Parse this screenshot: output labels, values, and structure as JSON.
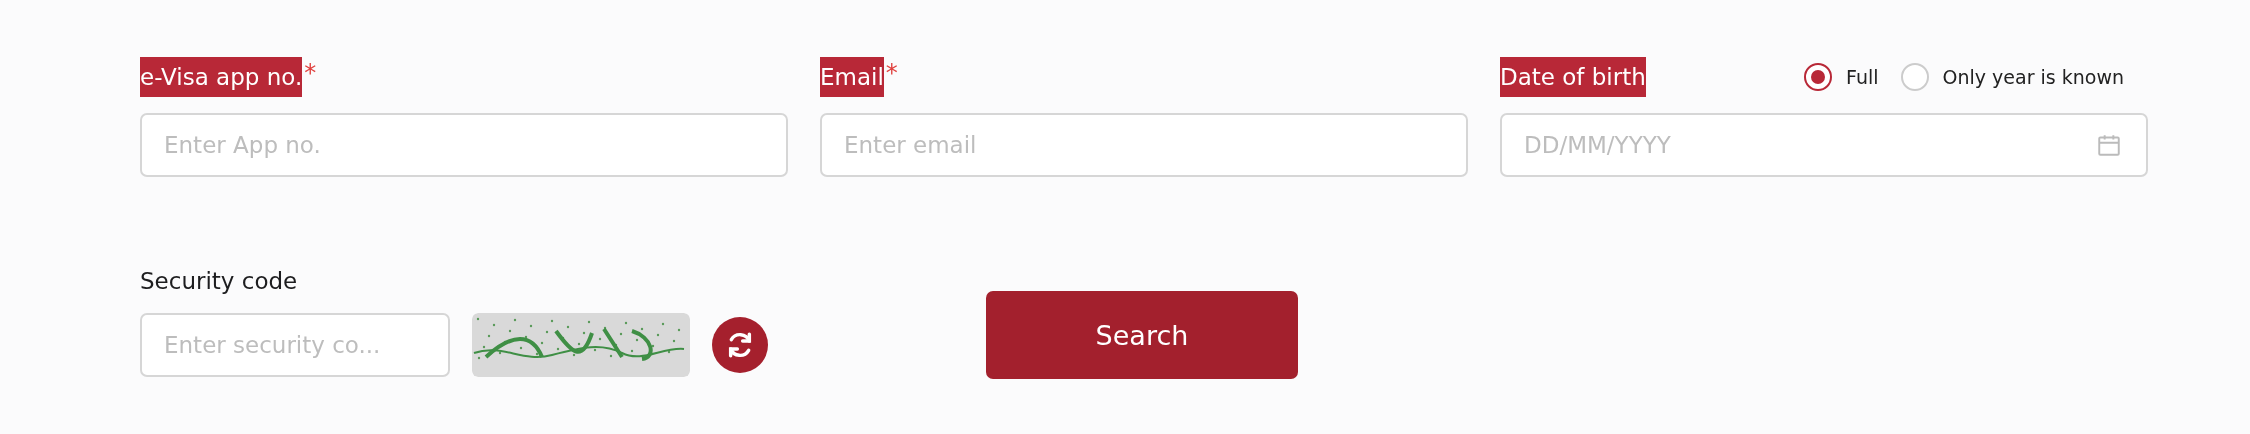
{
  "fields": [
    {
      "label": "e-Visa app no.",
      "highlighted": true,
      "required_mark": "*",
      "placeholder": "Enter App no."
    },
    {
      "label": "Email",
      "highlighted": true,
      "required_mark": "*",
      "placeholder": "Enter email"
    },
    {
      "label": "Date of birth",
      "highlighted": true,
      "placeholder": "DD/MM/YYYY",
      "kind": "date",
      "options": [
        {
          "label": "Full",
          "selected": true
        },
        {
          "label": "Only year is known",
          "selected": false
        }
      ]
    }
  ],
  "security": {
    "label": "Security code",
    "placeholder": "Enter security co..."
  },
  "search_button": "Search"
}
